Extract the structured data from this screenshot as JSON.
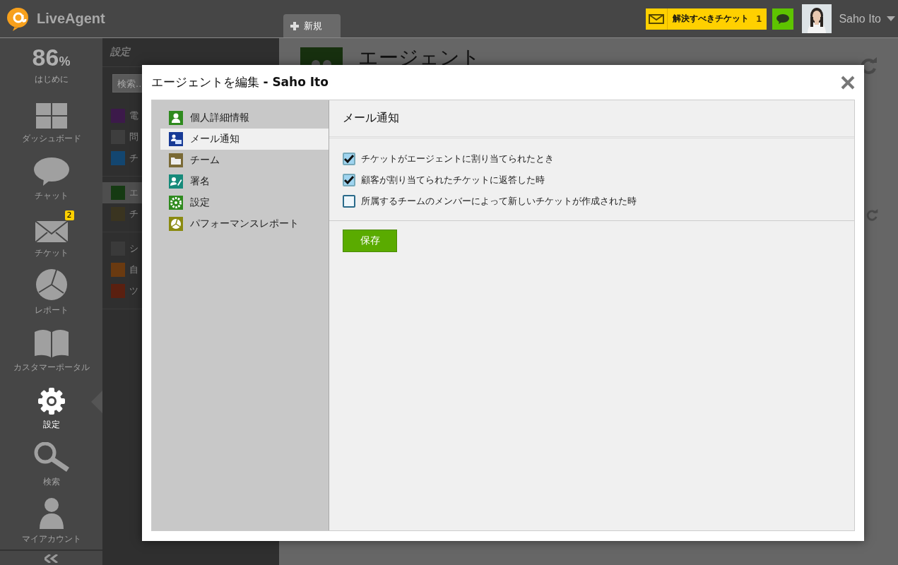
{
  "app": {
    "logo": "LiveAgent"
  },
  "top_bar": {
    "tabs": [
      {
        "label": "新規"
      }
    ],
    "tickets_button": {
      "label": "解決すべきチケット",
      "count": "1"
    },
    "user": {
      "name": "Saho Ito"
    }
  },
  "nav": {
    "progress": {
      "value": "86",
      "unit": "%",
      "label": "はじめに"
    },
    "items": [
      {
        "kind": "dashboard",
        "label": "ダッシュボード",
        "selected": false
      },
      {
        "kind": "chat",
        "label": "チャット",
        "selected": false
      },
      {
        "kind": "tickets",
        "label": "チケット",
        "selected": false,
        "badge": "2"
      },
      {
        "kind": "reports",
        "label": "レポート",
        "selected": false
      },
      {
        "kind": "portal",
        "label": "カスタマーポータル",
        "selected": false
      },
      {
        "kind": "settings",
        "label": "設定",
        "selected": true
      },
      {
        "kind": "search",
        "label": "検索",
        "selected": false
      },
      {
        "kind": "account",
        "label": "マイアカウント",
        "selected": false
      }
    ]
  },
  "settings_panel": {
    "title": "設定",
    "search": {
      "placeholder": "検索.."
    },
    "groups": [
      [
        {
          "kind": "email",
          "label": "電",
          "selected": false
        },
        {
          "kind": "doc",
          "label": "問",
          "selected": false
        },
        {
          "kind": "chat",
          "label": "チ",
          "selected": false
        }
      ],
      [
        {
          "kind": "agents",
          "label": "エ",
          "selected": true
        },
        {
          "kind": "folder",
          "label": "チ",
          "selected": false
        }
      ],
      [
        {
          "kind": "gear",
          "label": "シ",
          "selected": false
        },
        {
          "kind": "gears",
          "label": "自",
          "selected": false
        },
        {
          "kind": "tools",
          "label": "ツ",
          "selected": false
        }
      ]
    ]
  },
  "page": {
    "title": "エージェント"
  },
  "dialog": {
    "title": "エージェントを編集 **- Saho Ito**",
    "menu": [
      {
        "kind": "person",
        "label": "個人詳細情報",
        "selected": false
      },
      {
        "kind": "mail",
        "label": "メール通知",
        "selected": true
      },
      {
        "kind": "folder",
        "label": "チーム",
        "selected": false
      },
      {
        "kind": "signature",
        "label": "署名",
        "selected": false
      },
      {
        "kind": "gear",
        "label": "設定",
        "selected": false
      },
      {
        "kind": "report",
        "label": "パフォーマンスレポート",
        "selected": false
      }
    ],
    "section_title": "メール通知",
    "options": [
      {
        "label": "チケットがエージェントに割り当てられたとき",
        "checked": true
      },
      {
        "label": "顧客が割り当てられたチケットに返答した時",
        "checked": true
      },
      {
        "label": "所属するチームのメンバーによって新しいチケットが作成された時",
        "checked": false
      }
    ],
    "save_button": "保存"
  }
}
